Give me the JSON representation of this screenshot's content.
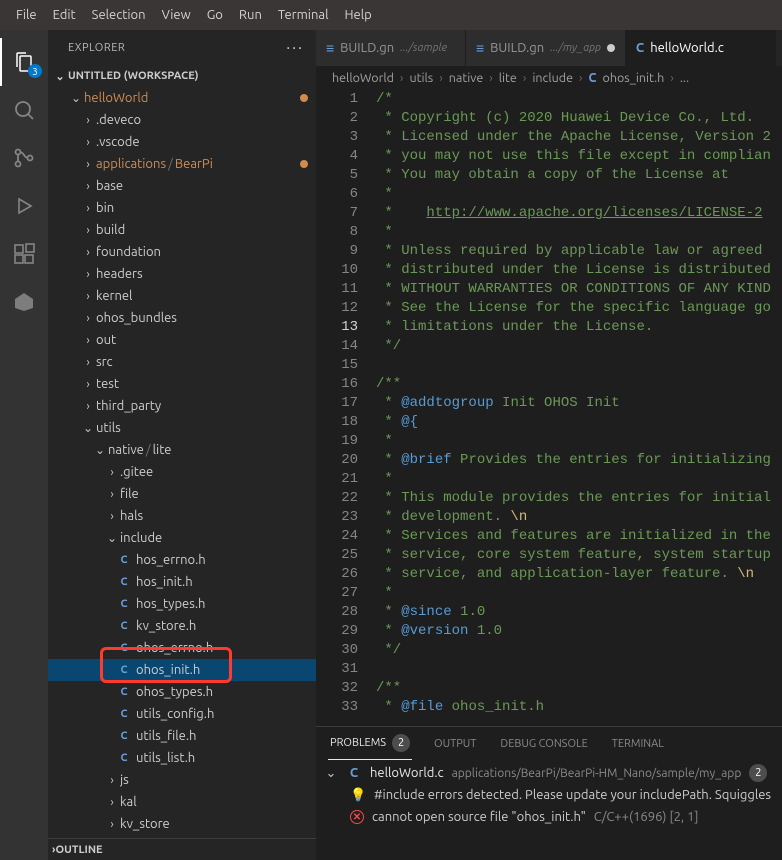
{
  "menu": [
    "File",
    "Edit",
    "Selection",
    "View",
    "Go",
    "Run",
    "Terminal",
    "Help"
  ],
  "activity": {
    "badge": "3"
  },
  "sidebar": {
    "title": "EXPLORER",
    "workspace": "UNTITLED (WORKSPACE)",
    "outline": "OUTLINE",
    "tree": [
      {
        "depth": 1,
        "kind": "folder",
        "open": true,
        "label": "helloWorld",
        "cls": "clr-orange",
        "dot": true
      },
      {
        "depth": 2,
        "kind": "folder",
        "open": false,
        "label": ".deveco"
      },
      {
        "depth": 2,
        "kind": "folder",
        "open": false,
        "label": ".vscode"
      },
      {
        "depth": 2,
        "kind": "folder",
        "open": false,
        "label": "applications",
        "cls": "clr-orange",
        "tail": "BearPi",
        "dot": true
      },
      {
        "depth": 2,
        "kind": "folder",
        "open": false,
        "label": "base"
      },
      {
        "depth": 2,
        "kind": "folder",
        "open": false,
        "label": "bin"
      },
      {
        "depth": 2,
        "kind": "folder",
        "open": false,
        "label": "build"
      },
      {
        "depth": 2,
        "kind": "folder",
        "open": false,
        "label": "foundation"
      },
      {
        "depth": 2,
        "kind": "folder",
        "open": false,
        "label": "headers"
      },
      {
        "depth": 2,
        "kind": "folder",
        "open": false,
        "label": "kernel"
      },
      {
        "depth": 2,
        "kind": "folder",
        "open": false,
        "label": "ohos_bundles"
      },
      {
        "depth": 2,
        "kind": "folder",
        "open": false,
        "label": "out"
      },
      {
        "depth": 2,
        "kind": "folder",
        "open": false,
        "label": "src"
      },
      {
        "depth": 2,
        "kind": "folder",
        "open": false,
        "label": "test"
      },
      {
        "depth": 2,
        "kind": "folder",
        "open": false,
        "label": "third_party"
      },
      {
        "depth": 2,
        "kind": "folder",
        "open": true,
        "label": "utils"
      },
      {
        "depth": 3,
        "kind": "folder",
        "open": true,
        "label": "native",
        "tail": "lite"
      },
      {
        "depth": 4,
        "kind": "folder",
        "open": false,
        "label": ".gitee"
      },
      {
        "depth": 4,
        "kind": "folder",
        "open": false,
        "label": "file"
      },
      {
        "depth": 4,
        "kind": "folder",
        "open": false,
        "label": "hals"
      },
      {
        "depth": 4,
        "kind": "folder",
        "open": true,
        "label": "include"
      },
      {
        "depth": 5,
        "kind": "c",
        "label": "hos_errno.h"
      },
      {
        "depth": 5,
        "kind": "c",
        "label": "hos_init.h"
      },
      {
        "depth": 5,
        "kind": "c",
        "label": "hos_types.h"
      },
      {
        "depth": 5,
        "kind": "c",
        "label": "kv_store.h"
      },
      {
        "depth": 5,
        "kind": "c",
        "label": "ohos_errno.h"
      },
      {
        "depth": 5,
        "kind": "c",
        "label": "ohos_init.h",
        "selected": true,
        "highlight": true
      },
      {
        "depth": 5,
        "kind": "c",
        "label": "ohos_types.h"
      },
      {
        "depth": 5,
        "kind": "c",
        "label": "utils_config.h"
      },
      {
        "depth": 5,
        "kind": "c",
        "label": "utils_file.h"
      },
      {
        "depth": 5,
        "kind": "c",
        "label": "utils_list.h"
      },
      {
        "depth": 4,
        "kind": "folder",
        "open": false,
        "label": "js"
      },
      {
        "depth": 4,
        "kind": "folder",
        "open": false,
        "label": "kal"
      },
      {
        "depth": 4,
        "kind": "folder",
        "open": false,
        "label": "kv_store"
      }
    ]
  },
  "tabs": [
    {
      "icon": "gn",
      "label": "BUILD.gn",
      "path": ".../sample",
      "active": false
    },
    {
      "icon": "gn",
      "label": "BUILD.gn",
      "path": ".../my_app",
      "active": false,
      "dirty": true
    },
    {
      "icon": "c",
      "label": "helloWorld.c",
      "active": true
    }
  ],
  "breadcrumbs": [
    "helloWorld",
    "utils",
    "native",
    "lite",
    "include",
    {
      "c": true,
      "t": "ohos_init.h"
    },
    "..."
  ],
  "code": {
    "current_line": 13,
    "lines": [
      {
        "n": 1,
        "html": "<span class='tk-c'>/*</span>"
      },
      {
        "n": 2,
        "html": "<span class='tk-c'> * Copyright (c) 2020 Huawei Device Co., Ltd.</span>"
      },
      {
        "n": 3,
        "html": "<span class='tk-c'> * Licensed under the Apache License, Version 2</span>"
      },
      {
        "n": 4,
        "html": "<span class='tk-c'> * you may not use this file except in complian</span>"
      },
      {
        "n": 5,
        "html": "<span class='tk-c'> * You may obtain a copy of the License at</span>"
      },
      {
        "n": 6,
        "html": "<span class='tk-c'> *</span>"
      },
      {
        "n": 7,
        "html": "<span class='tk-c'> *    </span><span class='tk-u'>http://www.apache.org/licenses/LICENSE-2</span>"
      },
      {
        "n": 8,
        "html": "<span class='tk-c'> *</span>"
      },
      {
        "n": 9,
        "html": "<span class='tk-c'> * Unless required by applicable law or agreed </span>"
      },
      {
        "n": 10,
        "html": "<span class='tk-c'> * distributed under the License is distributed</span>"
      },
      {
        "n": 11,
        "html": "<span class='tk-c'> * WITHOUT WARRANTIES OR CONDITIONS OF ANY KIND</span>"
      },
      {
        "n": 12,
        "html": "<span class='tk-c'> * See the License for the specific language go</span>"
      },
      {
        "n": 13,
        "html": "<span class='tk-c'> * limitations under the License.</span>"
      },
      {
        "n": 14,
        "html": "<span class='tk-c'> */</span>"
      },
      {
        "n": 15,
        "html": ""
      },
      {
        "n": 16,
        "html": "<span class='tk-c'>/**</span>"
      },
      {
        "n": 17,
        "html": "<span class='tk-c'> * </span><span class='tk-k'>@addtogroup</span><span class='tk-c'> Init OHOS Init</span>"
      },
      {
        "n": 18,
        "html": "<span class='tk-c'> * </span><span class='tk-k'>@{</span>"
      },
      {
        "n": 19,
        "html": "<span class='tk-c'> *</span>"
      },
      {
        "n": 20,
        "html": "<span class='tk-c'> * </span><span class='tk-k'>@brief</span><span class='tk-c'> Provides the entries for initializing</span>"
      },
      {
        "n": 21,
        "html": "<span class='tk-c'> *</span>"
      },
      {
        "n": 22,
        "html": "<span class='tk-c'> * This module provides the entries for initial</span>"
      },
      {
        "n": 23,
        "html": "<span class='tk-c'> * development. </span><span class='tk-esc'>\\n</span>"
      },
      {
        "n": 24,
        "html": "<span class='tk-c'> * Services and features are initialized in the</span>"
      },
      {
        "n": 25,
        "html": "<span class='tk-c'> * service, core system feature, system startup</span>"
      },
      {
        "n": 26,
        "html": "<span class='tk-c'> * service, and application-layer feature. </span><span class='tk-esc'>\\n</span>"
      },
      {
        "n": 27,
        "html": "<span class='tk-c'> *</span>"
      },
      {
        "n": 28,
        "html": "<span class='tk-c'> * </span><span class='tk-k'>@since</span><span class='tk-c'> 1.0</span>"
      },
      {
        "n": 29,
        "html": "<span class='tk-c'> * </span><span class='tk-k'>@version</span><span class='tk-c'> 1.0</span>"
      },
      {
        "n": 30,
        "html": "<span class='tk-c'> */</span>"
      },
      {
        "n": 31,
        "html": ""
      },
      {
        "n": 32,
        "html": "<span class='tk-c'>/**</span>"
      },
      {
        "n": 33,
        "html": "<span class='tk-c'> * </span><span class='tk-k'>@file</span><span class='tk-c'> ohos_init.h</span>"
      }
    ]
  },
  "panel": {
    "tabs": [
      {
        "label": "PROBLEMS",
        "count": "2",
        "active": true
      },
      {
        "label": "OUTPUT"
      },
      {
        "label": "DEBUG CONSOLE"
      },
      {
        "label": "TERMINAL"
      }
    ],
    "problems": {
      "file": "helloWorld.c",
      "path": "applications/BearPi/BearPi-HM_Nano/sample/my_app",
      "count": "2",
      "items": [
        {
          "icon": "bulb",
          "msg": "#include errors detected. Please update your includePath. Squiggles "
        },
        {
          "icon": "err",
          "msg": "cannot open source file \"ohos_init.h\"",
          "meta": "C/C++(1696)  [2, 1]"
        }
      ]
    }
  }
}
